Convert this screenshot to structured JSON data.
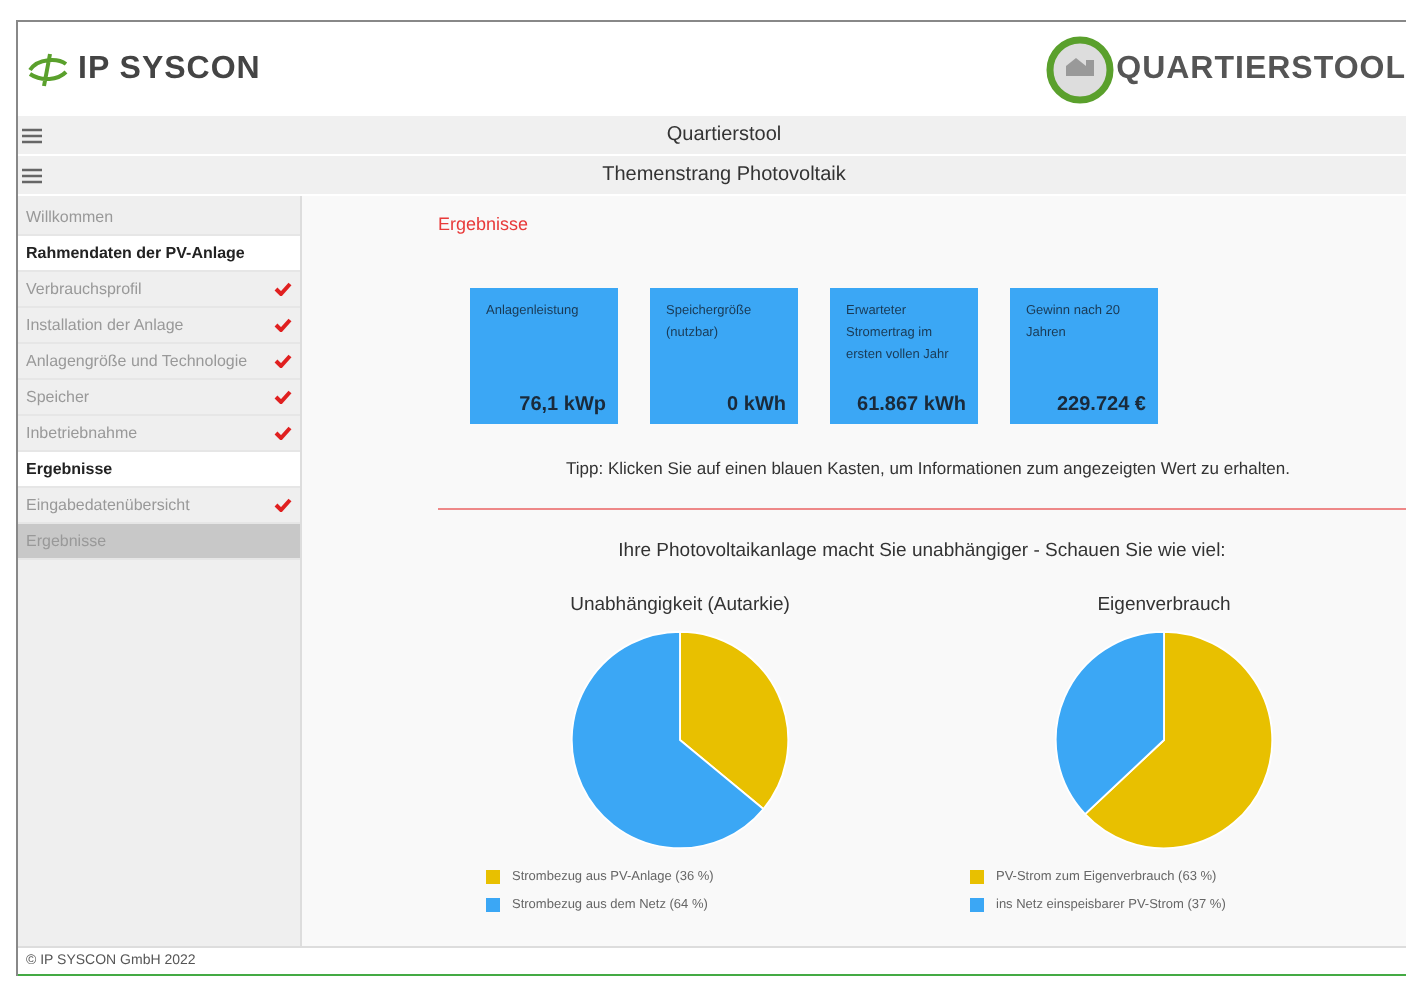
{
  "header": {
    "brand": "IP SYSCON",
    "product": "QUARTIERSTOOL"
  },
  "bars": [
    {
      "title": "Quartierstool"
    },
    {
      "title": "Themenstrang Photovoltaik"
    }
  ],
  "sidebar": {
    "items": [
      {
        "kind": "link",
        "label": "Willkommen",
        "checked": false,
        "selected": false
      },
      {
        "kind": "section",
        "label": "Rahmendaten der PV-Anlage"
      },
      {
        "kind": "link",
        "label": "Verbrauchsprofil",
        "checked": true,
        "selected": false
      },
      {
        "kind": "link",
        "label": "Installation der Anlage",
        "checked": true,
        "selected": false
      },
      {
        "kind": "link",
        "label": "Anlagengröße und Technologie",
        "checked": true,
        "selected": false
      },
      {
        "kind": "link",
        "label": "Speicher",
        "checked": true,
        "selected": false
      },
      {
        "kind": "link",
        "label": "Inbetriebnahme",
        "checked": true,
        "selected": false
      },
      {
        "kind": "section",
        "label": "Ergebnisse"
      },
      {
        "kind": "link",
        "label": "Eingabedatenübersicht",
        "checked": true,
        "selected": false
      },
      {
        "kind": "link",
        "label": "Ergebnisse",
        "checked": false,
        "selected": true
      }
    ]
  },
  "main": {
    "heading": "Ergebnisse",
    "tiles": [
      {
        "label": "Anlagenleistung",
        "value": "76,1 kWp"
      },
      {
        "label": "Speichergröße (nutzbar)",
        "value": "0 kWh"
      },
      {
        "label": "Erwarteter Stromertrag im ersten vollen Jahr",
        "value": "61.867 kWh"
      },
      {
        "label": "Gewinn nach 20 Jahren",
        "value": "229.724 €"
      }
    ],
    "tip": "Tipp: Klicken Sie auf einen blauen Kasten, um Informationen zum angezeigten Wert zu erhalten.",
    "subheading": "Ihre Photovoltaikanlage macht Sie unabhängiger - Schauen Sie wie viel:",
    "charts": [
      {
        "chart_data": {
          "type": "pie",
          "title": "Unabhängigkeit (Autarkie)",
          "legend": "bottom",
          "categories": [
            "Strombezug aus PV-Anlage (36 %)",
            "Strombezug aus dem Netz (64 %)"
          ],
          "series": [
            {
              "colors": [
                "#e8c000",
                "#3ba7f5"
              ],
              "values": [
                36,
                64
              ]
            }
          ]
        }
      },
      {
        "chart_data": {
          "type": "pie",
          "title": "Eigenverbrauch",
          "legend": "bottom",
          "categories": [
            "PV-Strom zum Eigenverbrauch (63 %)",
            "ins Netz einspeisbarer PV-Strom (37 %)"
          ],
          "series": [
            {
              "colors": [
                "#e8c000",
                "#3ba7f5"
              ],
              "values": [
                63,
                37
              ]
            }
          ]
        }
      }
    ]
  },
  "footer": "© IP SYSCON GmbH 2022"
}
